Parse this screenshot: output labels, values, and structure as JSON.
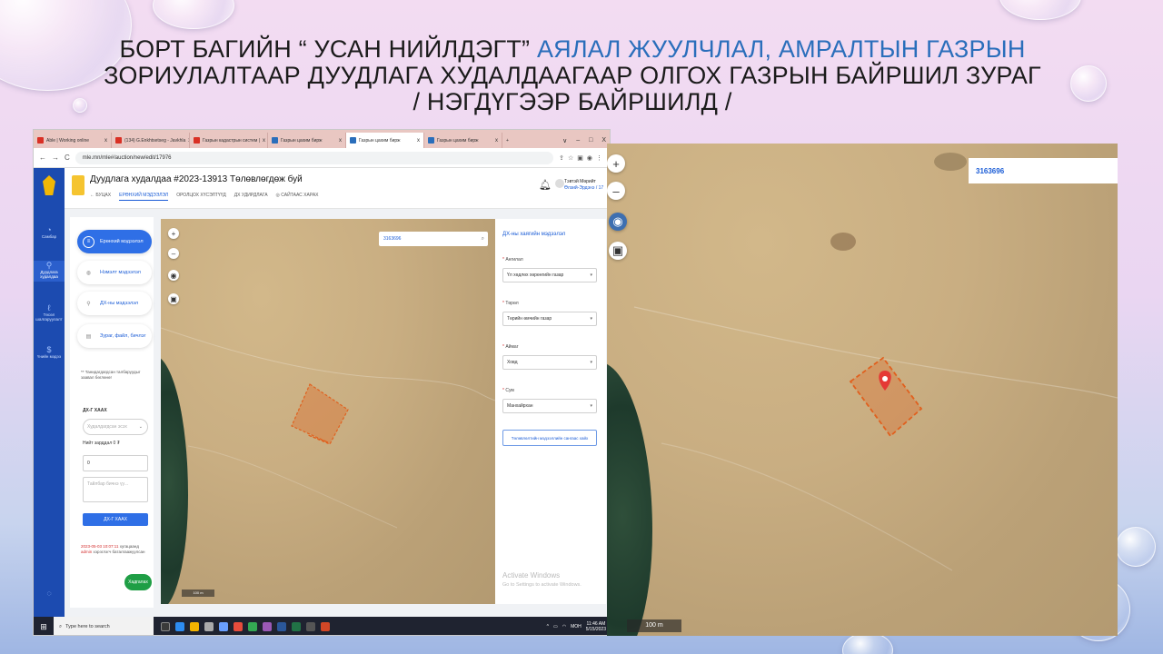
{
  "slide": {
    "title_line1_part1": "БОРТ БАГИЙН “ УСАН НИЙЛДЭГТ” ",
    "title_line1_part2": "АЯЛАЛ ЖУУЛЧЛАЛ, АМРАЛТЫН ГАЗРЫН",
    "title_line2": "ЗОРИУЛАЛТААР ДУУДЛАГА ХУДАЛДААГААР ОЛГОХ ГАЗРЫН  БАЙРШИЛ ЗУРАГ",
    "title_line3": "/ НЭГДҮГЭЭР БАЙРШИЛД /"
  },
  "browser": {
    "tabs": [
      {
        "label": "Able | Working online"
      },
      {
        "label": "(134) G.Enkhtsetseg - Javkhla"
      },
      {
        "label": "Газрын кадастрын систем |"
      },
      {
        "label": "Газрын цахим бирж"
      },
      {
        "label": "Газрын цахим бирж"
      },
      {
        "label": "Газрын цахим бирж"
      }
    ],
    "new_tab": "+",
    "win_controls": [
      "∨",
      "–",
      "□",
      "X"
    ],
    "url": "mle.mn/mle#/auction/new/edit/17976"
  },
  "app": {
    "sidebar": [
      {
        "label": "Самбар",
        "icon": "home-icon"
      },
      {
        "label": "Дуудлага худалдаа",
        "icon": "gavel-icon"
      },
      {
        "label": "Төсөл шалгаруулалт",
        "icon": "award-icon"
      },
      {
        "label": "Үнийн мэдээ",
        "icon": "price-icon"
      }
    ],
    "title": "Дуудлага худалдаа #2023-13913 Төлөвлөгдөж буй",
    "subtabs": [
      "← БУЦАХ",
      "ЕРӨНХИЙ МЭДЭЭЛЭЛ",
      "ОРОЛЦОХ ХҮСЭЛТҮҮД",
      "ДХ УДИРДЛАГА",
      "◎ САЙТААС ХАРАХ"
    ],
    "user_name": "Тэвтэй Мөрийт",
    "user_org": "Өлзий-Эрдэнэ / 17",
    "steps": [
      {
        "label": "Ерөнхий мэдээлэл",
        "icon": "list-icon"
      },
      {
        "label": "Нэмэлт мэдээлэл",
        "icon": "pin-icon"
      },
      {
        "label": "ДХ-ны мэдээлэл",
        "icon": "gavel-icon"
      },
      {
        "label": "Зураг, файл, бичлэг",
        "icon": "file-icon"
      }
    ],
    "form_note": "** Танидагдагдсан талбаруудыг заавал бөглөнө!",
    "dx_label": "ДХ-Г ХААХ",
    "dx_select_placeholder": "Худалдагдсан эсэх",
    "total_label": "Нийт зарддал 0 ₮",
    "total_value": "0",
    "textarea_placeholder": "Тайлбар бичнэ үү...",
    "close_btn": "ДХ-Г ХААХ",
    "log_time": "2023-05-03 10:07:11",
    "log_mid": " хугацаанд ",
    "log_user": "admin",
    "log_tail": " хэрэглэгч баталгаажуулсан",
    "save_btn": "Хадгалах",
    "map_search": "3163696",
    "map_scale": "100 m",
    "info_title": "ДХ-ны хаягийн мэдээлэл",
    "fields": [
      {
        "label": "Ангилал",
        "value": "Үл хөдлөх хөрөнгийн газар"
      },
      {
        "label": "Төрөл",
        "value": "Төрийн өмчийн газар"
      },
      {
        "label": "Аймаг",
        "value": "Ховд"
      },
      {
        "label": "Сум",
        "value": "Манхайрхан"
      }
    ],
    "info_btn": "Төлөвлөлтийн мэдээллийн сангаас хайх",
    "activate_title": "Activate Windows",
    "activate_sub": "Go to Settings to activate Windows."
  },
  "taskbar": {
    "search": "Type here to search",
    "time": "11:46 AM",
    "date": "5/15/2023",
    "lang": "МОН"
  },
  "big_map": {
    "search": "3163696",
    "scale": "100 m"
  },
  "colors": {
    "title_highlight": "#2a6ebb",
    "parcel": "#e0601e",
    "marker": "#e53935",
    "sidebar": "#1c4bb0",
    "primary": "#2f6fe6"
  }
}
